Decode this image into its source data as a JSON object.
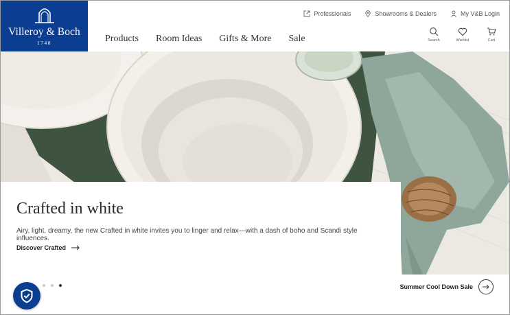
{
  "brand": {
    "name": "Villeroy & Boch",
    "year": "1748",
    "color": "#0b3d91"
  },
  "top_links": [
    {
      "label": "Professionals",
      "icon": "external-link-icon"
    },
    {
      "label": "Showrooms & Dealers",
      "icon": "location-pin-icon"
    },
    {
      "label": "My V&B Login",
      "icon": "user-icon"
    }
  ],
  "nav": [
    "Products",
    "Room Ideas",
    "Gifts & More",
    "Sale"
  ],
  "utility": [
    {
      "label": "Search",
      "icon": "search-icon"
    },
    {
      "label": "Wishlist",
      "icon": "heart-icon"
    },
    {
      "label": "Cart",
      "icon": "cart-icon"
    }
  ],
  "hero": {
    "title": "Crafted in white",
    "description": "Airy, light, dreamy, the new Crafted in white invites you to linger and relax—with a dash of boho and Scandi style influences.",
    "cta": "Discover Crafted",
    "slides": {
      "total": 3,
      "active": 3
    }
  },
  "next_promo": "Summer Cool Down Sale",
  "trust_badge": {
    "icon": "shield-check-icon"
  }
}
